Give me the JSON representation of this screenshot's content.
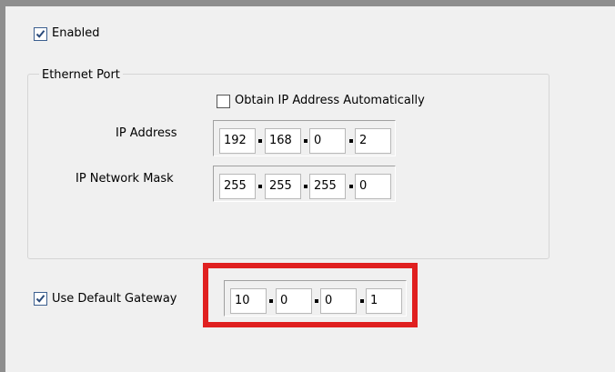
{
  "enabled": {
    "label": "Enabled",
    "checked": true
  },
  "ethernet_port": {
    "title": "Ethernet Port",
    "obtain_auto": {
      "label": "Obtain IP Address Automatically",
      "checked": false
    },
    "ip_address": {
      "label": "IP Address",
      "octets": [
        "192",
        "168",
        "0",
        "2"
      ]
    },
    "network_mask": {
      "label": "IP Network Mask",
      "octets": [
        "255",
        "255",
        "255",
        "0"
      ]
    }
  },
  "gateway": {
    "label": "Use Default Gateway",
    "checked": true,
    "octets": [
      "10",
      "0",
      "0",
      "1"
    ]
  },
  "colors": {
    "highlight": "#e02020",
    "check": "#2a4a7a"
  }
}
